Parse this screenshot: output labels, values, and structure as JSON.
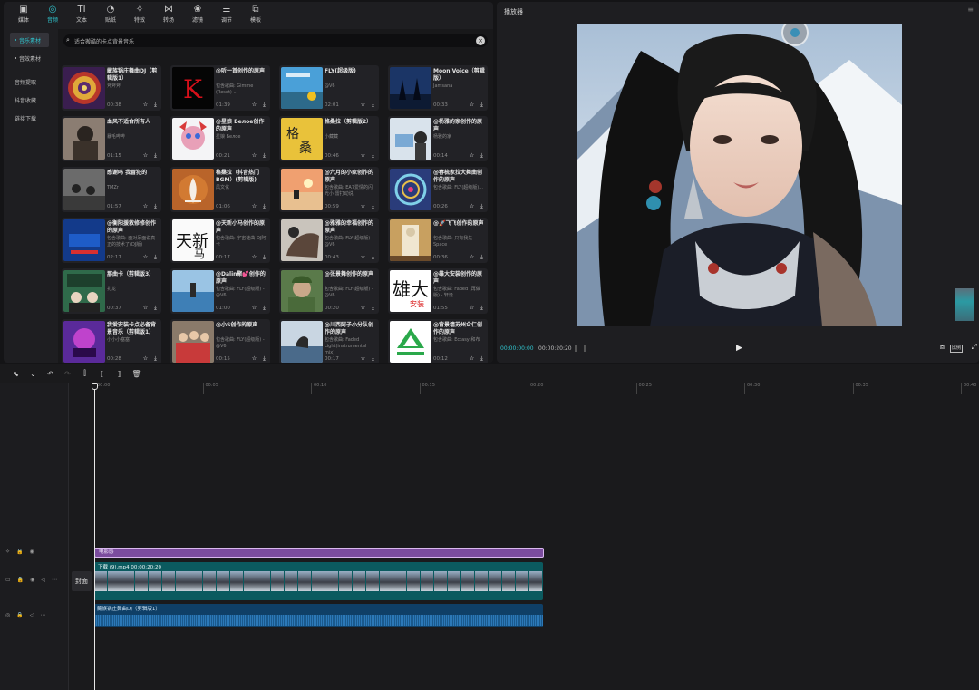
{
  "toolbar_tabs": [
    {
      "label": "媒体",
      "icon": "media-icon",
      "glyph": "▣"
    },
    {
      "label": "音频",
      "icon": "audio-icon",
      "glyph": "◎",
      "active": true
    },
    {
      "label": "文本",
      "icon": "text-icon",
      "glyph": "TI"
    },
    {
      "label": "贴纸",
      "icon": "sticker-icon",
      "glyph": "◔"
    },
    {
      "label": "特效",
      "icon": "effects-icon",
      "glyph": "✧"
    },
    {
      "label": "转场",
      "icon": "transition-icon",
      "glyph": "⋈"
    },
    {
      "label": "滤镜",
      "icon": "filter-icon",
      "glyph": "❀"
    },
    {
      "label": "调节",
      "icon": "adjust-icon",
      "glyph": "⚌"
    },
    {
      "label": "模板",
      "icon": "template-icon",
      "glyph": "⧉"
    }
  ],
  "sidebar": [
    {
      "label": "音乐素材",
      "active": true,
      "dot": true
    },
    {
      "label": "音效素材",
      "dot": true
    },
    {
      "label": "音频提取"
    },
    {
      "label": "抖音收藏"
    },
    {
      "label": "链接下载"
    }
  ],
  "search": {
    "value": "适合搬酷的卡点背景音乐"
  },
  "tracks": [
    {
      "title": "藏族锅庄舞曲DJ（剪辑版1）",
      "sub": "斧斧斧",
      "dur": "00:38",
      "thumb": "mandala"
    },
    {
      "title": "@听一首创作的原声",
      "sub": "包含歌曲: Gimme (Reset) ...",
      "dur": "01:39",
      "thumb": "redk"
    },
    {
      "title": "FLY(超级版)",
      "sub": "@V6",
      "dur": "02:01",
      "thumb": "sky"
    },
    {
      "title": "Moon Voice（剪辑版）",
      "sub": "Jamsana",
      "dur": "00:33",
      "thumb": "dusk"
    },
    {
      "title": "血风不适合所有人",
      "sub": "暴毛哔哔",
      "dur": "01:15",
      "thumb": "boxer"
    },
    {
      "title": "@星娘 Белое创作的原声",
      "sub": "星娘 Белое",
      "dur": "00:21",
      "thumb": "anime"
    },
    {
      "title": "格桑拉（剪辑版2）",
      "sub": "小藏藏",
      "dur": "00:46",
      "thumb": "calli"
    },
    {
      "title": "@杨雅的家创作的原声",
      "sub": "杨雅的家",
      "dur": "00:14",
      "thumb": "room"
    },
    {
      "title": "感谢吗 我冒犯的",
      "sub": "TMZr",
      "dur": "01:57",
      "thumb": "gym"
    },
    {
      "title": "格桑拉（抖音热门BGM）(剪辑版)",
      "sub": "风文化",
      "dur": "01:06",
      "thumb": "crane"
    },
    {
      "title": "@六月的小家创作的原声",
      "sub": "包含歌曲: EA7爱情的闪光小·雷打动说",
      "dur": "00:59",
      "thumb": "beach"
    },
    {
      "title": "@春梳家拉大舞曲创作的原声",
      "sub": "包含歌曲: FLY(超级版)...",
      "dur": "00:26",
      "thumb": "ferris"
    },
    {
      "title": "@衡阳援救修修创作的原声",
      "sub": "包含歌曲: 面对呆面说真正的技术了(DJ版)",
      "dur": "02:17",
      "thumb": "bluesign"
    },
    {
      "title": "@天新小马创作的原声",
      "sub": "包含歌曲: 宇宙谜曲-DJ阿卡",
      "dur": "00:17",
      "thumb": "brush"
    },
    {
      "title": "@雅雅的幸福创作的原声",
      "sub": "包含歌曲: FLY(超级版) - @V6",
      "dur": "00:43",
      "thumb": "hand"
    },
    {
      "title": "@🚀飞飞创作的原声",
      "sub": "包含歌曲: 只有我先-Space",
      "dur": "00:36",
      "thumb": "statue"
    },
    {
      "title": "那曲卡（剪辑版3）",
      "sub": "扎龙",
      "dur": "00:37",
      "thumb": "class"
    },
    {
      "title": "@Dalin聚💕创作的原声",
      "sub": "包含歌曲: FLY(超级版) - @V6",
      "dur": "01:00",
      "thumb": "sea"
    },
    {
      "title": "@张景舞创作的原声",
      "sub": "包含歌曲: FLY(超级版) - @V6",
      "dur": "00:20",
      "thumb": "soldier"
    },
    {
      "title": "@雄大安装创作的原声",
      "sub": "包含歌曲: Faded (再做版) - 轩逸",
      "dur": "01:55",
      "thumb": "bigtext"
    },
    {
      "title": "我爱安装卡点必备背景音乐（剪辑版1）",
      "sub": "小小小塞塞",
      "dur": "00:28",
      "thumb": "purple"
    },
    {
      "title": "@小S创作的原声",
      "sub": "包含歌曲: FLY(超级版) - @V6",
      "dur": "00:15",
      "thumb": "team"
    },
    {
      "title": "@川西阿子小分队创作的原声",
      "sub": "包含歌曲: Faded Light(instrumental mix)",
      "dur": "00:17",
      "thumb": "seal"
    },
    {
      "title": "@背景墙苏州众仁创作的原声",
      "sub": "包含歌曲: Ectasy-和布",
      "dur": "00:12",
      "thumb": "logo"
    }
  ],
  "player": {
    "title": "播放器",
    "current": "00:00:00:00",
    "total": "00:00:20:20",
    "ratio_label": "比例"
  },
  "ruler_ticks": [
    "00:00",
    "00:05",
    "00:10",
    "00:15",
    "00:20",
    "00:25",
    "00:30",
    "00:35",
    "00:40"
  ],
  "effect_clip": {
    "label": "电影感"
  },
  "video_clip": {
    "label": "下载 (9).mp4  00:00:20:20"
  },
  "audio_clip": {
    "label": "藏族锅庄舞曲DJ（剪辑版1）"
  },
  "cover_label": "封面",
  "colors": {
    "accent": "#30c6cf",
    "effect": "#7b4c9e",
    "video": "#0b5a5f",
    "audio": "#0f3f66"
  }
}
